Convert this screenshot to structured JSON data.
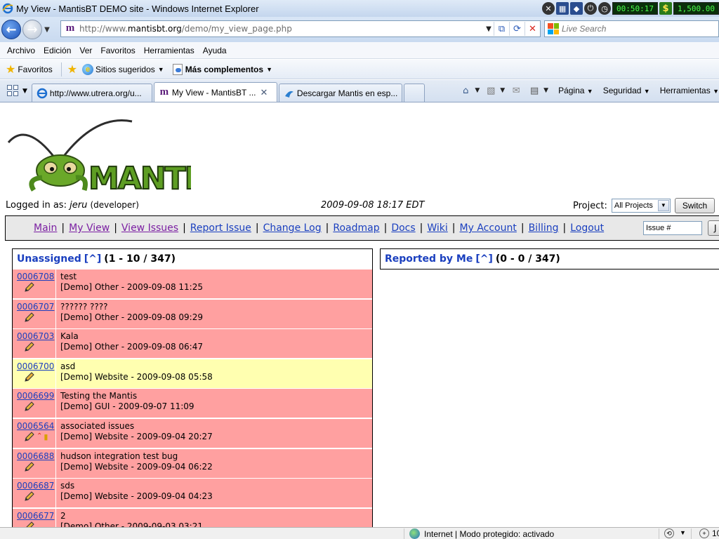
{
  "window": {
    "title": "My View - MantisBT DEMO site - Windows Internet Explorer",
    "timer": "00:50:17",
    "money": "1,500.00"
  },
  "address": {
    "url_prefix": "http://www.",
    "url_host": "mantisbt.org",
    "url_path": "/demo/my_view_page.php",
    "search_placeholder": "Live Search"
  },
  "menu": [
    "Archivo",
    "Edición",
    "Ver",
    "Favoritos",
    "Herramientas",
    "Ayuda"
  ],
  "favorites": {
    "favorites_label": "Favoritos",
    "suggested_label": "Sitios sugeridos",
    "addons_label": "Más complementos"
  },
  "tabs": [
    {
      "label": "http://www.utrera.org/u..."
    },
    {
      "label": "My View - MantisBT ..."
    },
    {
      "label": "Descargar Mantis en esp..."
    }
  ],
  "command_bar": {
    "page_label": "Página",
    "security_label": "Seguridad",
    "tools_label": "Herramientas"
  },
  "page": {
    "logo_text": "MANTIS",
    "logged_in_label": "Logged in as:",
    "username": "jeru",
    "role": "(developer)",
    "datetime": "2009-09-08 18:17 EDT",
    "project_label": "Project:",
    "project_value": "All Projects",
    "switch_label": "Switch",
    "issue_placeholder": "Issue #",
    "jump_label": "J"
  },
  "nav": [
    {
      "label": "Main",
      "visited": true
    },
    {
      "label": "My View",
      "visited": true
    },
    {
      "label": "View Issues",
      "visited": true
    },
    {
      "label": "Report Issue",
      "visited": false
    },
    {
      "label": "Change Log",
      "visited": false
    },
    {
      "label": "Roadmap",
      "visited": false
    },
    {
      "label": "Docs",
      "visited": false
    },
    {
      "label": "Wiki",
      "visited": false
    },
    {
      "label": "My Account",
      "visited": false
    },
    {
      "label": "Billing",
      "visited": false
    },
    {
      "label": "Logout",
      "visited": false
    }
  ],
  "unassigned": {
    "title": "Unassigned",
    "caret": "[^]",
    "counts": "(1 - 10 / 347)",
    "issues": [
      {
        "id": "0006708",
        "summary": "test",
        "detail": "[Demo] Other - 2009-09-08 11:25",
        "color": "#ffa0a0",
        "extra_icons": false
      },
      {
        "id": "0006707",
        "summary": "?????? ????",
        "detail": "[Demo] Other - 2009-09-08 09:29",
        "color": "#ffa0a0",
        "extra_icons": false
      },
      {
        "id": "0006703",
        "summary": "Kala",
        "detail": "[Demo] Other - 2009-09-08 06:47",
        "color": "#ffa0a0",
        "extra_icons": false
      },
      {
        "id": "0006700",
        "summary": "asd",
        "detail": "[Demo] Website - 2009-09-08 05:58",
        "color": "#ffffb0",
        "extra_icons": false
      },
      {
        "id": "0006699",
        "summary": "Testing the Mantis",
        "detail": "[Demo] GUI - 2009-09-07 11:09",
        "color": "#ffa0a0",
        "extra_icons": false
      },
      {
        "id": "0006564",
        "summary": "associated issues",
        "detail": "[Demo] Website - 2009-09-04 20:27",
        "color": "#ffa0a0",
        "extra_icons": true
      },
      {
        "id": "0006688",
        "summary": "hudson integration test bug",
        "detail": "[Demo] Website - 2009-09-04 06:22",
        "color": "#ffa0a0",
        "extra_icons": false
      },
      {
        "id": "0006687",
        "summary": "sds",
        "detail": "[Demo] Website - 2009-09-04 04:23",
        "color": "#ffa0a0",
        "extra_icons": false
      },
      {
        "id": "0006677",
        "summary": "2",
        "detail": "[Demo] Other - 2009-09-03 03:21",
        "color": "#ffa0a0",
        "extra_icons": false
      }
    ]
  },
  "reported": {
    "title": "Reported by Me",
    "caret": "[^]",
    "counts": "(0 - 0 / 347)"
  },
  "status": {
    "zone_text": "Internet | Modo protegido: activado",
    "zoom_text": "10"
  }
}
